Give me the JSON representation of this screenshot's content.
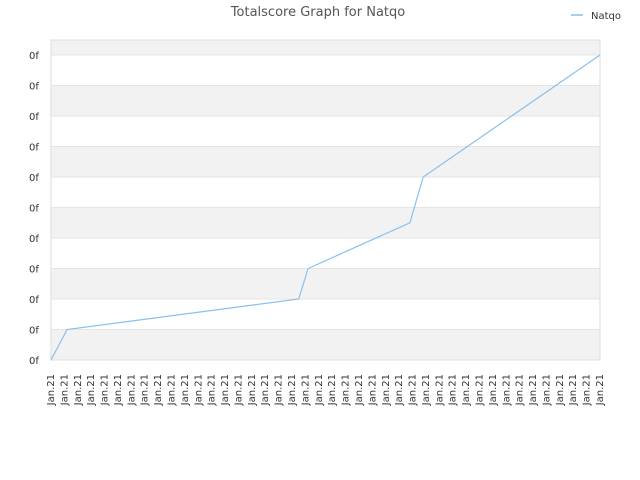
{
  "chart_data": {
    "type": "line",
    "title": "Totalscore Graph for Natqo",
    "xlabel": "",
    "ylabel": "",
    "x_labels": [
      "Jan.21",
      "Jan.21",
      "Jan.21",
      "Jan.21",
      "Jan.21",
      "Jan.21",
      "Jan.21",
      "Jan.21",
      "Jan.21",
      "Jan.21",
      "Jan.21",
      "Jan.21",
      "Jan.21",
      "Jan.21",
      "Jan.21",
      "Jan.21",
      "Jan.21",
      "Jan.21",
      "Jan.21",
      "Jan.21",
      "Jan.21",
      "Jan.21",
      "Jan.21",
      "Jan.21",
      "Jan.21",
      "Jan.21",
      "Jan.21",
      "Jan.21",
      "Jan.21",
      "Jan.21",
      "Jan.21",
      "Jan.21",
      "Jan.21",
      "Jan.21",
      "Jan.21",
      "Jan.21",
      "Jan.21",
      "Jan.21",
      "Jan.21",
      "Jan.21",
      "Jan.21",
      "Jan.21"
    ],
    "y_tick_labels": [
      "0f",
      "0f",
      "0f",
      "0f",
      "0f",
      "0f",
      "0f",
      "0f",
      "0f",
      "0f",
      "0f"
    ],
    "ylim": [
      0,
      10
    ],
    "grid": true,
    "legend_position": "top-right",
    "series": [
      {
        "name": "Natqo",
        "color": "#88c0ee",
        "points": [
          {
            "x": 0.0,
            "y": 0.0
          },
          {
            "x": 1.2,
            "y": 1.0
          },
          {
            "x": 18.5,
            "y": 2.0
          },
          {
            "x": 19.2,
            "y": 3.0
          },
          {
            "x": 26.8,
            "y": 4.5
          },
          {
            "x": 27.8,
            "y": 6.0
          },
          {
            "x": 41.0,
            "y": 10.0
          }
        ]
      }
    ]
  }
}
